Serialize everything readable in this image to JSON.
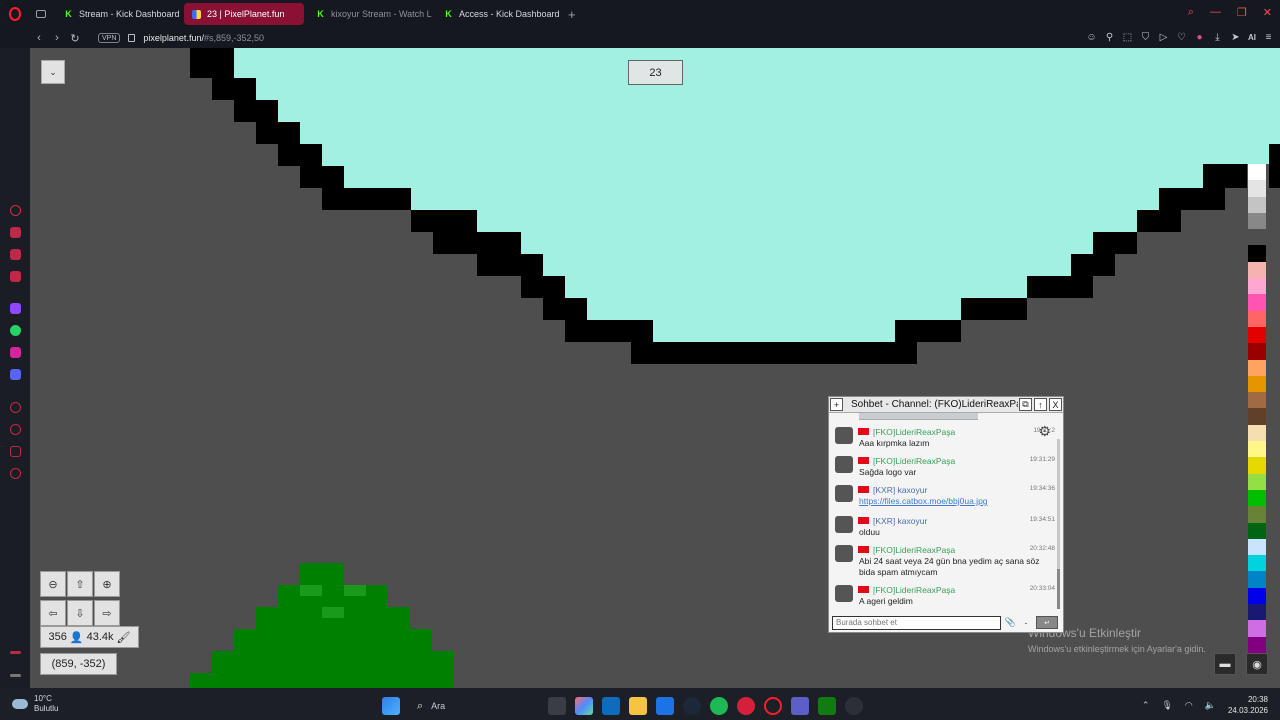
{
  "tabs": [
    {
      "label": "Stream - Kick Dashboard",
      "active": false,
      "fav": "K"
    },
    {
      "label": "23 | PixelPlanet.fun",
      "active": true,
      "fav": ""
    },
    {
      "label": "kixoyur Stream - Watch Li",
      "active": false,
      "fav": "K"
    },
    {
      "label": "Access - Kick Dashboard",
      "active": false,
      "fav": "K"
    }
  ],
  "address": {
    "vpn": "VPN",
    "host": "pixelplanet.fun/",
    "path": "#s,859,-352,50"
  },
  "toolbar": {
    "ai_label": "AI"
  },
  "canvas": {
    "online_count": "23",
    "user_count": "356",
    "pixels_placed": "43.4k",
    "coordinates": "(859, -352)"
  },
  "chat": {
    "title": "Sohbet - Channel: (FKO)LideriReaxPaşa",
    "input_placeholder": "Burada sohbet et",
    "messages": [
      {
        "name": "[FKO]LideriReaxPaşa",
        "time": "19:31:2",
        "text": "Aaa kırpmka lazım",
        "color": "#3aa05a"
      },
      {
        "name": "[FKO]LideriReaxPaşa",
        "time": "19:31:29",
        "text": "Sağda logo var",
        "color": "#3aa05a"
      },
      {
        "name": "[KXR] kaxoyur",
        "time": "19:34:36",
        "text": "https://files.catbox.moe/bbj0ua.jpg",
        "color": "#4a6fb0",
        "link": true
      },
      {
        "name": "[KXR] kaxoyur",
        "time": "19:34:51",
        "text": "olduu",
        "color": "#4a6fb0"
      },
      {
        "name": "[FKO]LideriReaxPaşa",
        "time": "20:32:48",
        "text": "Abi 24 saat veya 24 gün bna yedim aç sana söz bida spam atmıycam",
        "color": "#3aa05a"
      },
      {
        "name": "[FKO]LideriReaxPaşa",
        "time": "20:33:04",
        "text": "A ageri geldim",
        "color": "#3aa05a"
      }
    ]
  },
  "palette": [
    "#ffffff",
    "#e4e4e4",
    "#c4c4c4",
    "#888888",
    "#4e4e4e",
    "#000000",
    "#f4b3ae",
    "#ffa7d1",
    "#ff54b2",
    "#ff6565",
    "#e50000",
    "#9a0000",
    "#fea460",
    "#e59500",
    "#a06a42",
    "#604028",
    "#f5dfb0",
    "#fff889",
    "#e5d900",
    "#94e044",
    "#02be01",
    "#688338",
    "#006513",
    "#cae3ff",
    "#00d3dd",
    "#0083c7",
    "#0000ea",
    "#191973",
    "#cf6ee4",
    "#820080"
  ],
  "watermark": {
    "line1": "Windows'u Etkinleştir",
    "line2": "Windows'u etkinleştirmek için Ayarlar'a gidin."
  },
  "taskbar": {
    "weather_temp": "10°C",
    "weather_desc": "Bulutlu",
    "search_label": "Ara",
    "time": "20:38",
    "date": "24.03.2026"
  }
}
